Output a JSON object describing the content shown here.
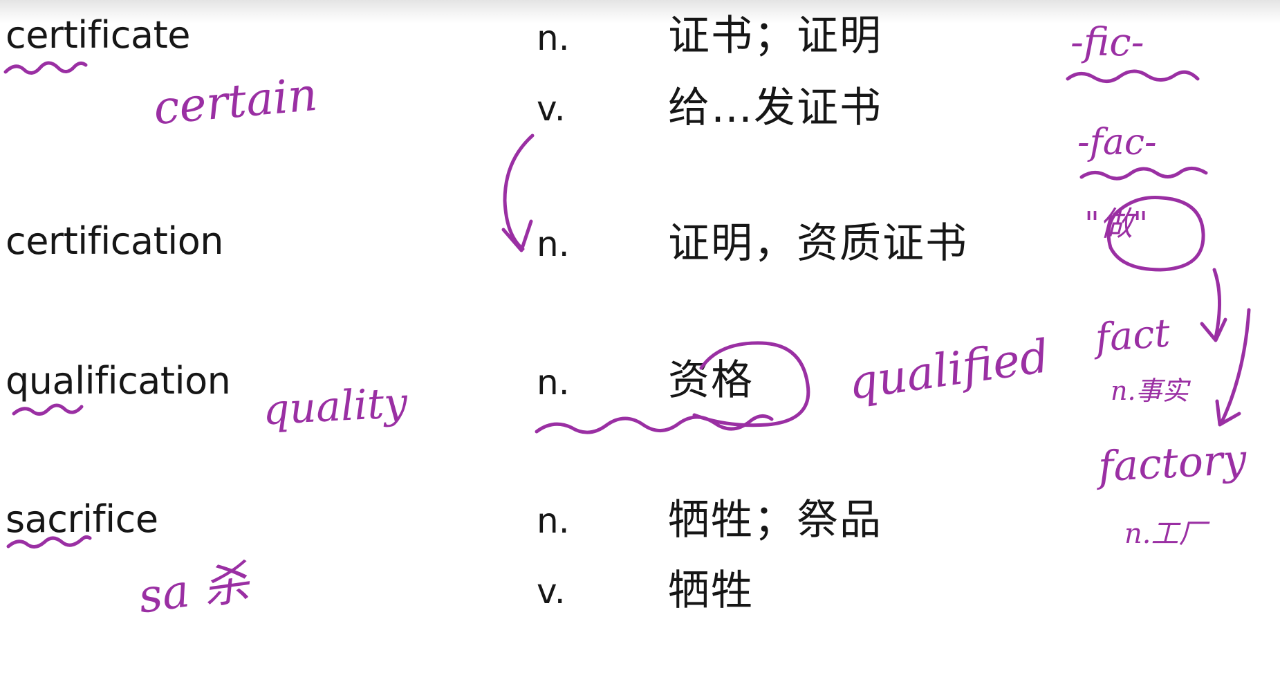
{
  "entries": [
    {
      "word": "certificate",
      "senses": [
        {
          "pos": "n.",
          "meaning": "证书；证明"
        },
        {
          "pos": "v.",
          "meaning": "给…发证书"
        }
      ]
    },
    {
      "word": "certification",
      "senses": [
        {
          "pos": "n.",
          "meaning": "证明，资质证书"
        }
      ]
    },
    {
      "word": "qualification",
      "senses": [
        {
          "pos": "n.",
          "meaning": "资格"
        }
      ]
    },
    {
      "word": "sacrifice",
      "senses": [
        {
          "pos": "n.",
          "meaning": "牺牲；祭品"
        },
        {
          "pos": "v.",
          "meaning": "牺牲"
        }
      ]
    }
  ],
  "notes": {
    "certain": "certain",
    "quality": "quality",
    "qualified": "qualified",
    "sa": "sa 杀",
    "fic": "-fic-",
    "fac": "-fac-",
    "zuo": "\"做\"",
    "fact": "fact",
    "fact_meaning": "n.事实",
    "factory": "factory",
    "factory_meaning": "n.工厂"
  },
  "colors": {
    "ink": "#9a2fa3",
    "text": "#161616"
  }
}
